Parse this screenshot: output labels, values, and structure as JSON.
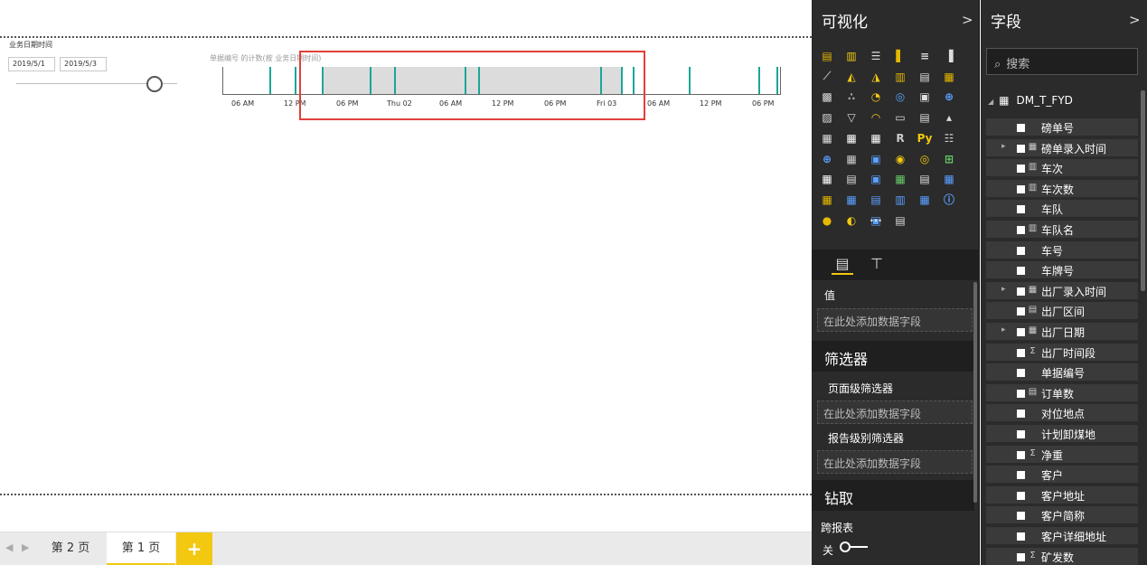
{
  "slicer": {
    "title": "业务日期时间",
    "start_date": "2019/5/1",
    "end_date": "2019/5/3"
  },
  "timeline": {
    "caption": "单据编号 的计数(按 业务日期时间)",
    "accent_color": "#1aa69a",
    "tick_labels": [
      "06 AM",
      "12 PM",
      "06 PM",
      "Thu 02",
      "06 AM",
      "12 PM",
      "06 PM",
      "Fri 03",
      "06 AM",
      "12 PM",
      "06 PM"
    ]
  },
  "page_tabs": {
    "prev": "◀",
    "next": "▶",
    "tabs": [
      "第 2 页",
      "第 1 页"
    ],
    "active_index": 1,
    "add": "+"
  },
  "viz_pane": {
    "title": "可视化",
    "chevron": ">",
    "values_label": "值",
    "values_placeholder": "在此处添加数据字段",
    "filters_title": "筛选器",
    "page_filters_label": "页面级筛选器",
    "page_filters_placeholder": "在此处添加数据字段",
    "report_filters_label": "报告级别筛选器",
    "report_filters_placeholder": "在此处添加数据字段",
    "drill_title": "钻取",
    "cross_report_label": "跨报表",
    "toggle_state": "关",
    "more_icon": "···",
    "icon_names": [
      "stacked-bar",
      "stacked-column",
      "clustered-bar",
      "clustered-column",
      "100-bar",
      "100-column",
      "line",
      "area",
      "stacked-area",
      "line-column",
      "line-clustered",
      "ribbon",
      "waterfall",
      "scatter",
      "pie",
      "donut",
      "treemap",
      "map",
      "filled-map",
      "funnel",
      "gauge",
      "card",
      "multi-row-card",
      "kpi",
      "slicer",
      "table",
      "matrix",
      "r-visual",
      "python-visual",
      "key-influencers",
      "decomposition-tree",
      "shape-map",
      "qna",
      "smart-narrative",
      "arcgis-map",
      "custom-1",
      "custom-2",
      "custom-3",
      "custom-4",
      "custom-5",
      "custom-6",
      "custom-7",
      "custom-8",
      "custom-9",
      "custom-10",
      "custom-11",
      "custom-12",
      "custom-13",
      "custom-14",
      "custom-15",
      "custom-16",
      "custom-17"
    ]
  },
  "fields_pane": {
    "title": "字段",
    "chevron": ">",
    "search_placeholder": "搜索",
    "table_name": "DM_T_FYD",
    "fields": [
      {
        "name": "磅单号",
        "icon": "",
        "expand": false
      },
      {
        "name": "磅单录入时间",
        "icon": "▦",
        "expand": true
      },
      {
        "name": "车次",
        "icon": "▥",
        "expand": false
      },
      {
        "name": "车次数",
        "icon": "▥",
        "expand": false
      },
      {
        "name": "车队",
        "icon": "",
        "expand": false
      },
      {
        "name": "车队名",
        "icon": "▥",
        "expand": false
      },
      {
        "name": "车号",
        "icon": "",
        "expand": false
      },
      {
        "name": "车牌号",
        "icon": "",
        "expand": false
      },
      {
        "name": "出厂录入时间",
        "icon": "▦",
        "expand": true
      },
      {
        "name": "出厂区间",
        "icon": "▤",
        "expand": false
      },
      {
        "name": "出厂日期",
        "icon": "▦",
        "expand": true
      },
      {
        "name": "出厂时间段",
        "icon": "Σ",
        "expand": false
      },
      {
        "name": "单据编号",
        "icon": "",
        "expand": false
      },
      {
        "name": "订单数",
        "icon": "▤",
        "expand": false
      },
      {
        "name": "对位地点",
        "icon": "",
        "expand": false
      },
      {
        "name": "计划卸煤地",
        "icon": "",
        "expand": false
      },
      {
        "name": "净重",
        "icon": "Σ",
        "expand": false
      },
      {
        "name": "客户",
        "icon": "",
        "expand": false
      },
      {
        "name": "客户地址",
        "icon": "",
        "expand": false
      },
      {
        "name": "客户简称",
        "icon": "",
        "expand": false
      },
      {
        "name": "客户详细地址",
        "icon": "",
        "expand": false
      },
      {
        "name": "矿发数",
        "icon": "Σ",
        "expand": false
      }
    ]
  }
}
